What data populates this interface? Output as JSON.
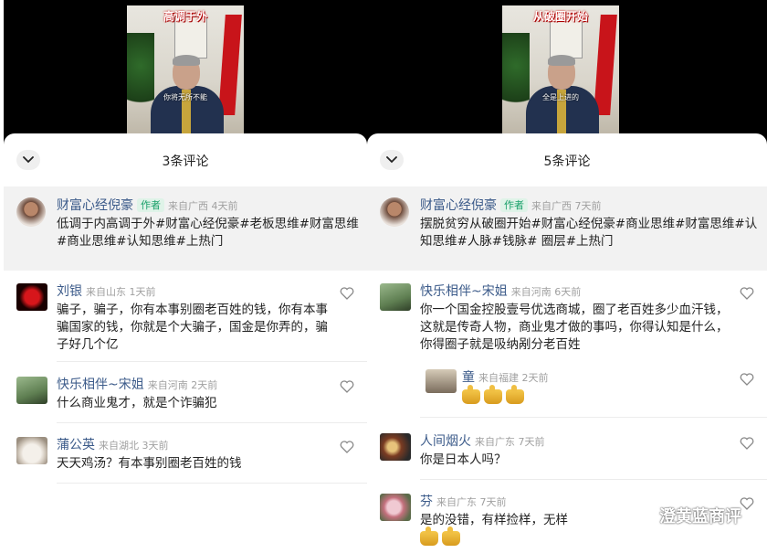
{
  "left": {
    "video": {
      "title": "高调于外",
      "subtitle": "你将无所不能"
    },
    "sheet_title": "3条评论",
    "pinned": {
      "name": "财富心经倪豪",
      "tag": "作者",
      "meta": "来自广西 4天前",
      "text": "低调于内高调于外#财富心经倪豪#老板思维#财富思维#商业思维#认知思维#上热门"
    },
    "comments": [
      {
        "name": "刘银",
        "meta": "来自山东 1天前",
        "text": "骗子，骗子，你有本事别圈老百姓的钱，你有本事骗国家的钱，你就是个大骗子，国金是你弄的，骗子好几个亿"
      },
      {
        "name": "快乐相伴~宋姐",
        "meta": "来自河南 2天前",
        "text": "什么商业鬼才，就是个诈骗犯"
      },
      {
        "name": "蒲公英",
        "meta": "来自湖北 3天前",
        "text": "天天鸡汤？有本事别圈老百姓的钱"
      }
    ]
  },
  "right": {
    "video": {
      "title": "从破圈开始",
      "subtitle": "全是上进的"
    },
    "sheet_title": "5条评论",
    "pinned": {
      "name": "财富心经倪豪",
      "tag": "作者",
      "meta": "来自广西 7天前",
      "text": "摆脱贫穷从破圈开始#财富心经倪豪#商业思维#财富思维#认知思维#人脉#钱脉# 圈层#上热门"
    },
    "comments": [
      {
        "name": "快乐相伴~宋姐",
        "meta": "来自河南 6天前",
        "text": "你一个国金控股壹号优选商城，圈了老百姓多少血汗钱，这就是传奇人物，商业鬼才做的事吗，你得认知是什么，你得圈子就是吸纳剐分老百姓"
      },
      {
        "name": "人间烟火",
        "meta": "来自广东 7天前",
        "text": "你是日本人吗？"
      },
      {
        "name": "芬",
        "meta": "来自广东 7天前",
        "text": "是的没错，有样捡样，无样"
      }
    ],
    "reply": {
      "name": "童",
      "meta": "来自福建 2天前"
    }
  },
  "watermark": "澄黄蓝商评"
}
